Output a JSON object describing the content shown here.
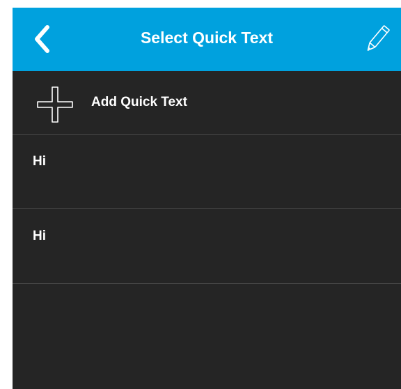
{
  "header": {
    "title": "Select Quick Text",
    "back_icon": "chevron-left-icon",
    "edit_icon": "pencil-icon",
    "background_color": "#00a1de"
  },
  "add_row": {
    "label": "Add Quick Text",
    "icon": "plus-icon"
  },
  "quick_texts": [
    {
      "text": "Hi"
    },
    {
      "text": "Hi"
    }
  ],
  "colors": {
    "background": "#252525",
    "divider": "#4a4a4a",
    "text": "#ffffff"
  }
}
